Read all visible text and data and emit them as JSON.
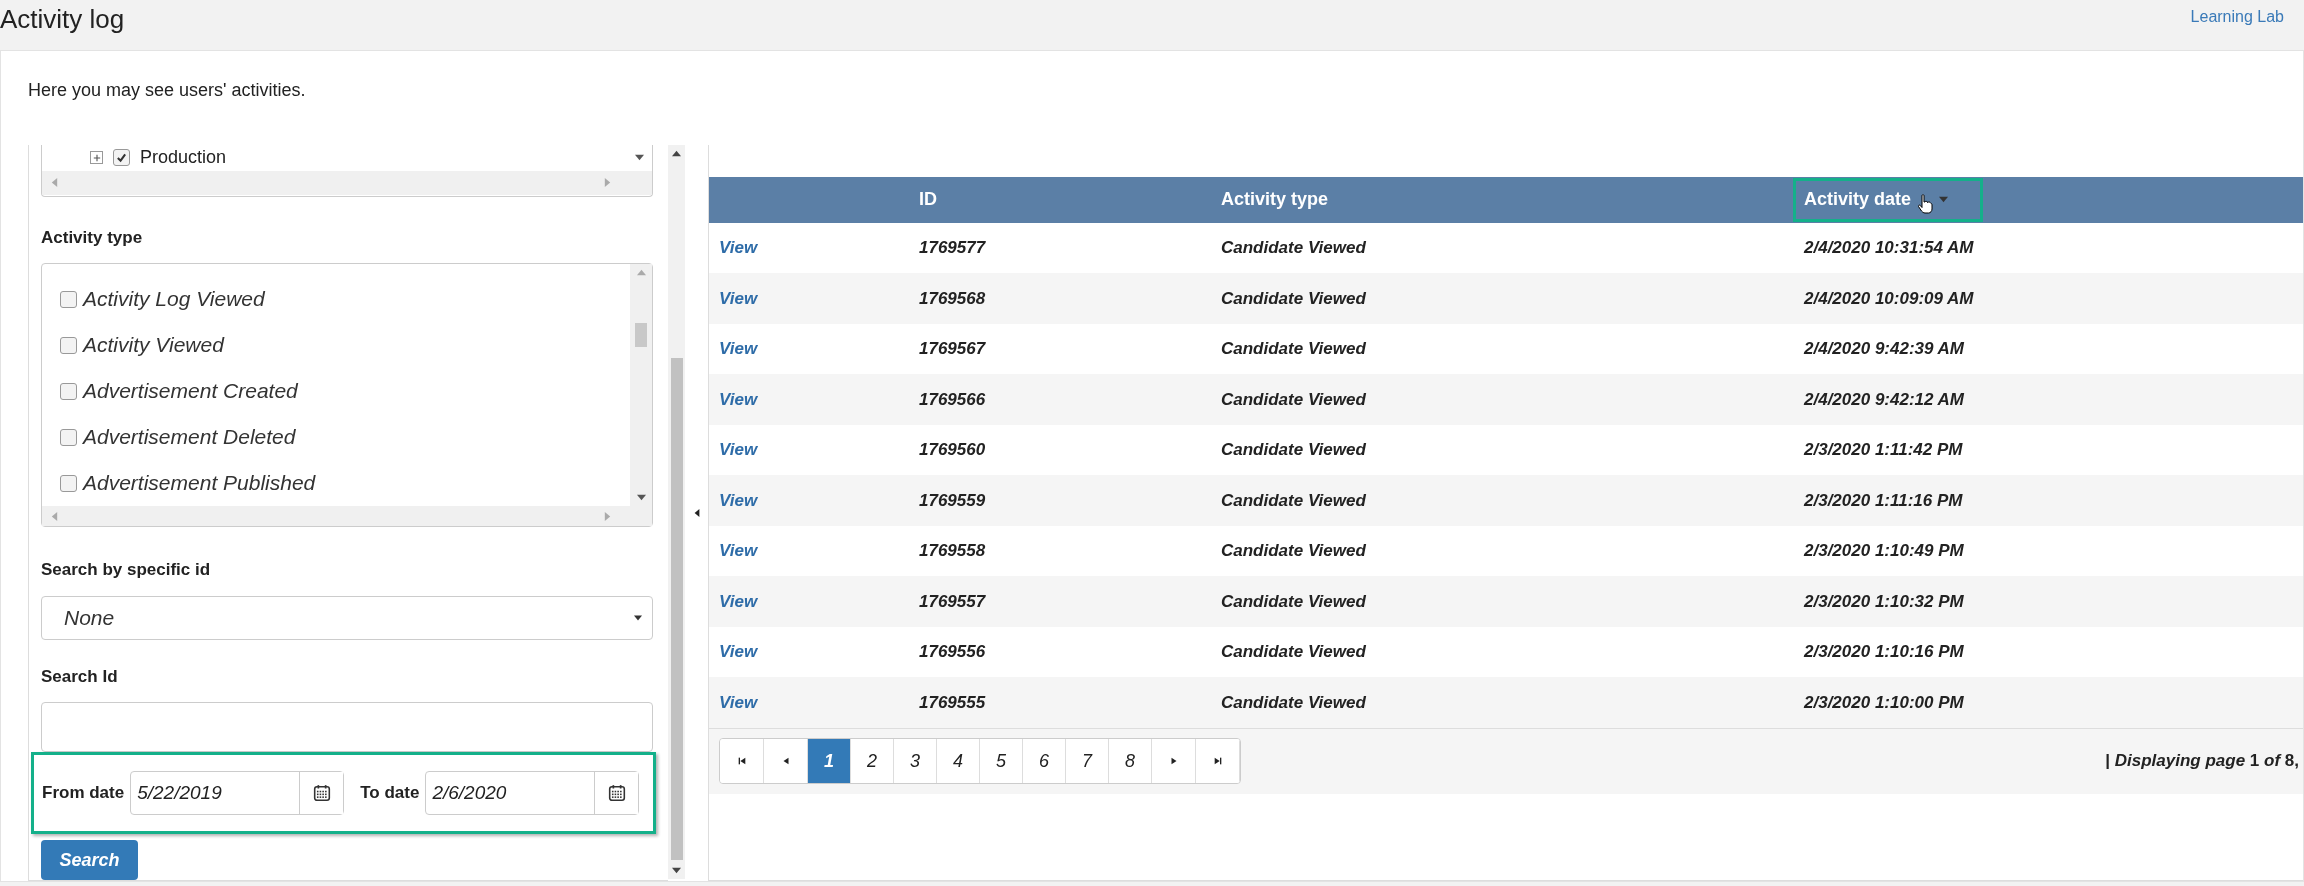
{
  "header": {
    "title": "Activity log",
    "link": "Learning Lab"
  },
  "intro": "Here you may see users' activities.",
  "filters": {
    "tree_item": {
      "label": "Production",
      "checked": true,
      "expanded": false
    },
    "activity_type": {
      "label": "Activity type",
      "options": [
        {
          "label": "Activity Log Viewed",
          "checked": false
        },
        {
          "label": "Activity Viewed",
          "checked": false
        },
        {
          "label": "Advertisement Created",
          "checked": false
        },
        {
          "label": "Advertisement Deleted",
          "checked": false
        },
        {
          "label": "Advertisement Published",
          "checked": false
        }
      ]
    },
    "specific_id": {
      "label": "Search by specific id",
      "value": "None"
    },
    "search_id": {
      "label": "Search Id"
    },
    "from_date": {
      "label": "From date",
      "value": "5/22/2019"
    },
    "to_date": {
      "label": "To date",
      "value": "2/6/2020"
    },
    "search_button": "Search"
  },
  "table": {
    "columns": [
      {
        "label": "ID",
        "sorted": false
      },
      {
        "label": "Activity type",
        "sorted": false
      },
      {
        "label": "Activity date",
        "sorted": true
      }
    ],
    "rows": [
      {
        "link": "View",
        "id": "1769577",
        "type": "Candidate Viewed",
        "date": "2/4/2020 10:31:54 AM"
      },
      {
        "link": "View",
        "id": "1769568",
        "type": "Candidate Viewed",
        "date": "2/4/2020 10:09:09 AM"
      },
      {
        "link": "View",
        "id": "1769567",
        "type": "Candidate Viewed",
        "date": "2/4/2020 9:42:39 AM"
      },
      {
        "link": "View",
        "id": "1769566",
        "type": "Candidate Viewed",
        "date": "2/4/2020 9:42:12 AM"
      },
      {
        "link": "View",
        "id": "1769560",
        "type": "Candidate Viewed",
        "date": "2/3/2020 1:11:42 PM"
      },
      {
        "link": "View",
        "id": "1769559",
        "type": "Candidate Viewed",
        "date": "2/3/2020 1:11:16 PM"
      },
      {
        "link": "View",
        "id": "1769558",
        "type": "Candidate Viewed",
        "date": "2/3/2020 1:10:49 PM"
      },
      {
        "link": "View",
        "id": "1769557",
        "type": "Candidate Viewed",
        "date": "2/3/2020 1:10:32 PM"
      },
      {
        "link": "View",
        "id": "1769556",
        "type": "Candidate Viewed",
        "date": "2/3/2020 1:10:16 PM"
      },
      {
        "link": "View",
        "id": "1769555",
        "type": "Candidate Viewed",
        "date": "2/3/2020 1:10:00 PM"
      }
    ]
  },
  "pagination": {
    "pages": [
      {
        "label": "1",
        "selected": true
      },
      {
        "label": "2",
        "selected": false
      },
      {
        "label": "3",
        "selected": false
      },
      {
        "label": "4",
        "selected": false
      },
      {
        "label": "5",
        "selected": false
      },
      {
        "label": "6",
        "selected": false
      },
      {
        "label": "7",
        "selected": false
      },
      {
        "label": "8",
        "selected": false
      }
    ],
    "status": "| *Displaying page* 1 *of* 8,"
  }
}
